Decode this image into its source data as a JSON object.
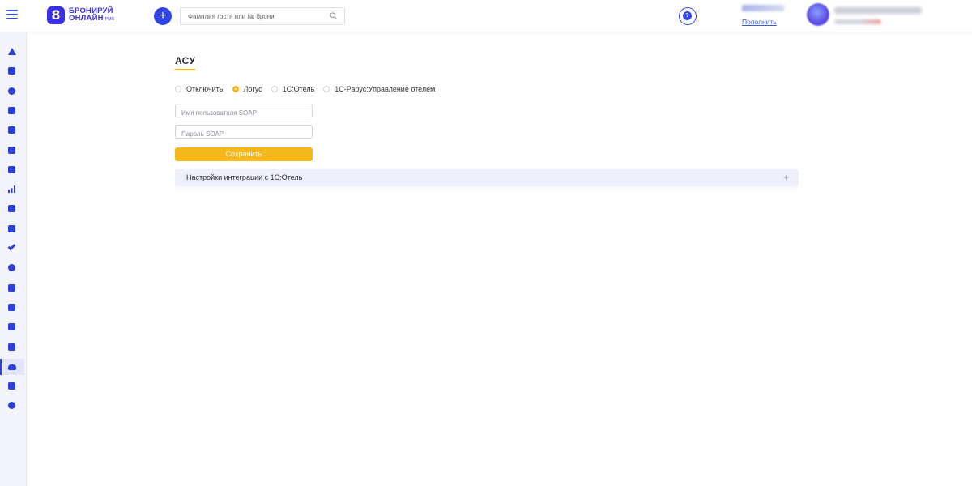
{
  "header": {
    "logo_mark": "8",
    "logo_line1": "БРОНИРУЙ",
    "logo_line2": "ОНЛАЙН",
    "logo_suffix": "PMS",
    "add_label": "+",
    "search_placeholder": "Фамилия гостя или № брони",
    "help_label": "?",
    "topup_link": "Пополнить"
  },
  "sidebar": {
    "items": [
      {
        "icon": "dashboard-icon",
        "shape": "tri"
      },
      {
        "icon": "calendar-icon",
        "shape": "square"
      },
      {
        "icon": "user-icon",
        "shape": "round"
      },
      {
        "icon": "tasks-icon",
        "shape": "square"
      },
      {
        "icon": "tag-icon",
        "shape": "square"
      },
      {
        "icon": "folder-icon",
        "shape": "square"
      },
      {
        "icon": "stack-icon",
        "shape": "square"
      },
      {
        "icon": "bar-chart-icon",
        "shape": "bars"
      },
      {
        "icon": "checklist-icon",
        "shape": "square"
      },
      {
        "icon": "rocket-icon",
        "shape": "square"
      },
      {
        "icon": "check-icon",
        "shape": "check"
      },
      {
        "icon": "gear-icon",
        "shape": "round"
      },
      {
        "icon": "mail-icon",
        "shape": "square"
      },
      {
        "icon": "wallet-icon",
        "shape": "square"
      },
      {
        "icon": "database-icon",
        "shape": "square"
      },
      {
        "icon": "badge-icon",
        "shape": "square"
      },
      {
        "icon": "cloud-icon",
        "shape": "cloud",
        "active": true
      },
      {
        "icon": "megaphone-icon",
        "shape": "square"
      },
      {
        "icon": "person-icon",
        "shape": "round"
      }
    ]
  },
  "main": {
    "section_title": "АСУ",
    "radio_options": [
      {
        "label": "Отключить",
        "checked": false
      },
      {
        "label": "Логус",
        "checked": true
      },
      {
        "label": "1С:Отель",
        "checked": false
      },
      {
        "label": "1С-Рарус:Управление отелем",
        "checked": false
      }
    ],
    "username_placeholder": "Имя пользователя SOAP",
    "password_placeholder": "Пароль SOAP",
    "save_label": "Сохранить",
    "accordion_title": "Настройки интеграции с 1С:Отель",
    "accordion_toggle": "+"
  },
  "colors": {
    "brand_blue": "#2f45e6",
    "accent_yellow": "#f7b81d",
    "sidebar_bg": "#f3f4fc"
  }
}
